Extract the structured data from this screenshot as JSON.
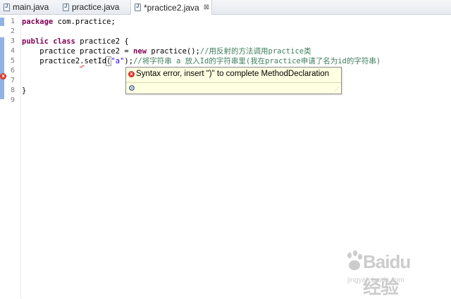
{
  "tabs": [
    {
      "label": "main.java"
    },
    {
      "label": "practice.java"
    },
    {
      "label": "*practice2.java",
      "close": "⊠"
    }
  ],
  "line_numbers": [
    "1",
    "2",
    "3",
    "4",
    "5",
    "6",
    "7",
    "8",
    "9"
  ],
  "code": {
    "line1": {
      "kw": "package",
      "rest": " com.practice;"
    },
    "line3": {
      "kw1": "public",
      "kw2": "class",
      "rest": " practice2 {"
    },
    "line4": {
      "a": "    practice practice2 = ",
      "kw": "new",
      "b": " practice();",
      "comment": "//用反射的方法调用practice类"
    },
    "line5": {
      "a": "    practice2",
      "squig": ".",
      "b": "setId",
      "c": "(",
      "str": "\"a\"",
      "d": ");",
      "comment": "//将字符串 a 放入Id的字符串里(我在practice申请了名为id的字符串)"
    },
    "line8": {
      "rest": "}"
    }
  },
  "popup": {
    "message": "Syntax error, insert \")\" to complete MethodDeclaration"
  },
  "colors": {
    "keyword": "#7f0055",
    "comment": "#3f7f5f",
    "string": "#2a00ff",
    "error": "#d9342b",
    "tooltip_bg": "#ffffe1"
  },
  "watermark": {
    "brand": "Baidu经验",
    "url": "jingyan.baidu.com"
  }
}
